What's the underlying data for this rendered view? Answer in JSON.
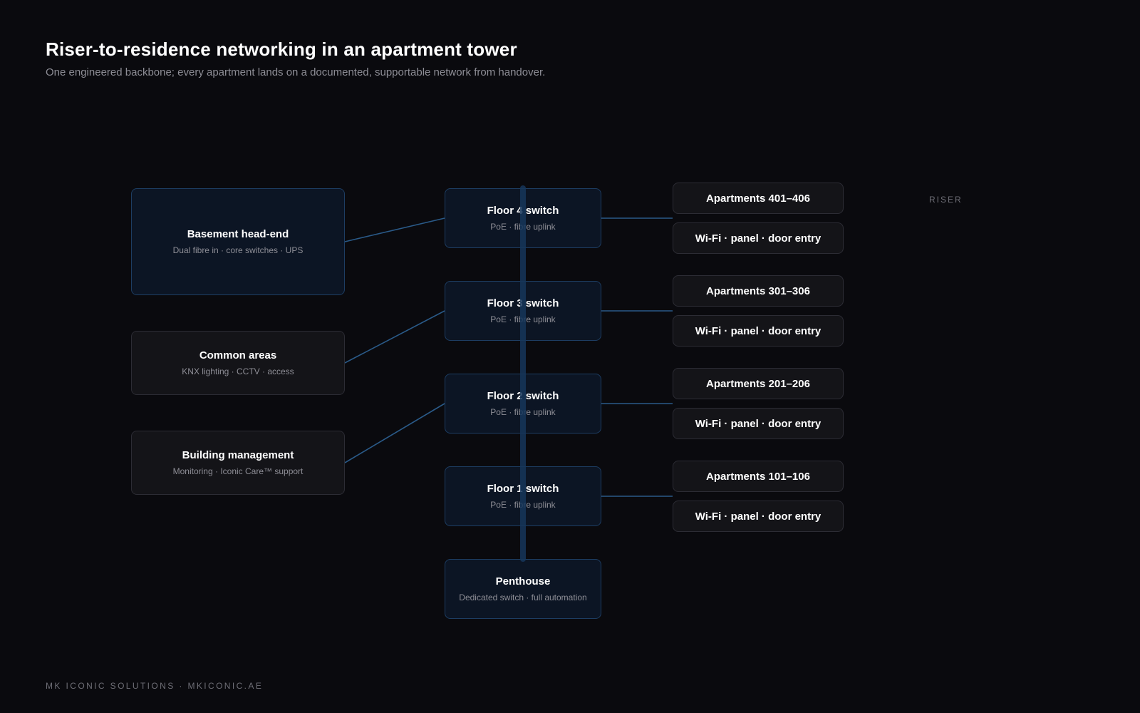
{
  "header": {
    "title": "Riser-to-residence networking in an apartment tower",
    "subtitle": "One engineered backbone; every apartment lands on a documented, supportable network from handover."
  },
  "riser_label": "RISER",
  "left_nodes": [
    {
      "title": "Basement head-end",
      "subtitle": "Dual fibre in · core switches · UPS"
    },
    {
      "title": "Common areas",
      "subtitle": "KNX lighting · CCTV · access"
    },
    {
      "title": "Building management",
      "subtitle": "Monitoring · Iconic Care™ support"
    }
  ],
  "floors": [
    {
      "title": "Floor 4 switch",
      "subtitle": "PoE · fibre uplink",
      "apartments": "Apartments 401–406",
      "services": "Wi-Fi · panel · door entry"
    },
    {
      "title": "Floor 3 switch",
      "subtitle": "PoE · fibre uplink",
      "apartments": "Apartments 301–306",
      "services": "Wi-Fi · panel · door entry"
    },
    {
      "title": "Floor 2 switch",
      "subtitle": "PoE · fibre uplink",
      "apartments": "Apartments 201–206",
      "services": "Wi-Fi · panel · door entry"
    },
    {
      "title": "Floor 1 switch",
      "subtitle": "PoE · fibre uplink",
      "apartments": "Apartments 101–106",
      "services": "Wi-Fi · panel · door entry"
    }
  ],
  "penthouse": {
    "title": "Penthouse",
    "subtitle": "Dedicated switch · full automation"
  },
  "footer": "MK ICONIC SOLUTIONS · MKICONIC.AE",
  "colors": {
    "background": "#0a0a0e",
    "connector": "#2a5a88",
    "node_blue": "#0c1524",
    "node_dark": "#141418"
  }
}
